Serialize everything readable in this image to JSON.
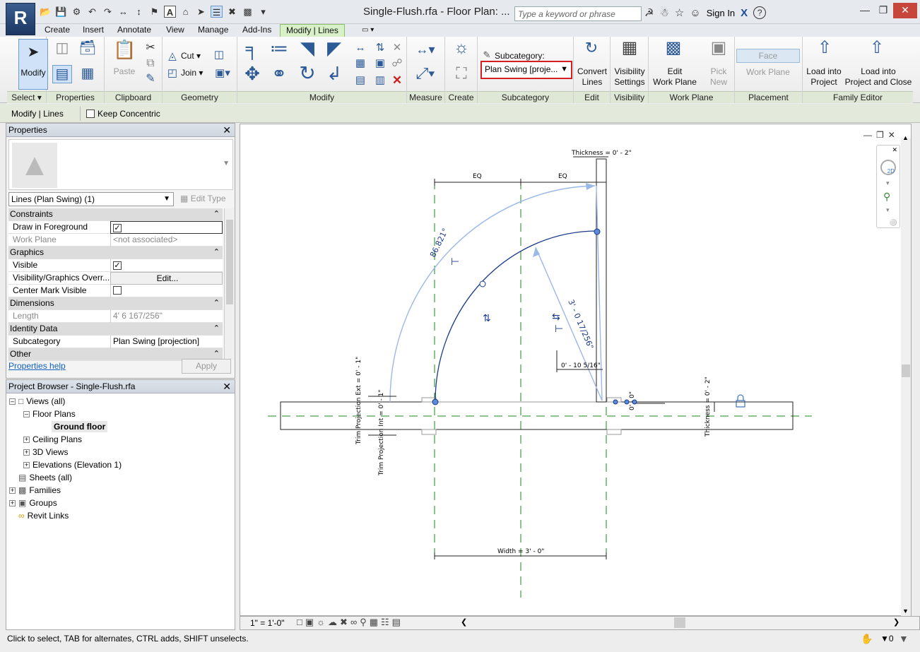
{
  "app": {
    "logo": "R",
    "window_title": "Single-Flush.rfa - Floor Plan: ...",
    "search_placeholder": "Type a keyword or phrase",
    "sign_in": "Sign In",
    "help": "?"
  },
  "tabs": [
    "Create",
    "Insert",
    "Annotate",
    "View",
    "Manage",
    "Add-Ins",
    "Modify | Lines"
  ],
  "ribbon": {
    "select": {
      "modify": "Modify",
      "footer": "Select ▾"
    },
    "properties": {
      "footer": "Properties"
    },
    "clipboard": {
      "paste": "Paste",
      "footer": "Clipboard"
    },
    "geometry": {
      "cut": "Cut",
      "join": "Join",
      "footer": "Geometry"
    },
    "modify": {
      "footer": "Modify"
    },
    "measure": {
      "footer": "Measure"
    },
    "create": {
      "footer": "Create"
    },
    "subcategory": {
      "label": "Subcategory:",
      "value": "Plan Swing [proje...",
      "footer": "Subcategory"
    },
    "edit": {
      "convert1": "Convert",
      "convert2": "Lines",
      "footer": "Edit"
    },
    "visibility": {
      "l1": "Visibility",
      "l2": "Settings",
      "footer": "Visibility"
    },
    "workplane": {
      "l1": "Edit",
      "l2": "Work Plane",
      "footer": "Work Plane"
    },
    "picknew": {
      "l1": "Pick",
      "l2": "New"
    },
    "placement": {
      "face": "Face",
      "workplane": "Work Plane",
      "footer": "Placement"
    },
    "family": {
      "load1": "Load into",
      "load2": "Project",
      "lc1": "Load into",
      "lc2": "Project and Close",
      "footer": "Family Editor"
    }
  },
  "options_bar": {
    "context": "Modify | Lines",
    "keep_concentric": "Keep Concentric"
  },
  "properties": {
    "title": "Properties",
    "type_selector": "Lines (Plan Swing) (1)",
    "edit_type": "Edit Type",
    "rows": {
      "constraints": "Constraints",
      "draw_fg": "Draw in Foreground",
      "work_plane": "Work Plane",
      "work_plane_val": "<not associated>",
      "graphics": "Graphics",
      "visible": "Visible",
      "vg_overrides": "Visibility/Graphics Overr...",
      "vg_edit": "Edit...",
      "center_mark": "Center Mark Visible",
      "dimensions": "Dimensions",
      "length": "Length",
      "length_val": "4'  6 167/256\"",
      "identity": "Identity Data",
      "subcategory": "Subcategory",
      "subcategory_val": "Plan Swing [projection]",
      "other": "Other"
    },
    "help": "Properties help",
    "apply": "Apply"
  },
  "browser": {
    "title": "Project Browser - Single-Flush.rfa",
    "items": [
      "Views (all)",
      "Floor Plans",
      "Ground floor",
      "Ceiling Plans",
      "3D Views",
      "Elevations (Elevation 1)",
      "Sheets (all)",
      "Families",
      "Groups",
      "Revit Links"
    ]
  },
  "drawing": {
    "thickness_top": "Thickness = 0' - 2\"",
    "eq": "EQ",
    "angle": "86.821°",
    "radius": "3' - 0 17/256\"",
    "offset": "0' - 10 5/16\"",
    "trim_ext": "Trim Projection Ext = 0' - 1\"",
    "trim_int": "Trim Projection Int = 0' - 1\"",
    "thickness_right": "Thickness = 0' - 2\"",
    "small_dim": "0' - 0\"",
    "width": "Width = 3' - 0\""
  },
  "view_control": {
    "scale": "1\" = 1'-0\""
  },
  "status": {
    "text": "Click to select, TAB for alternates, CTRL adds, SHIFT unselects.",
    "filter_count": "0"
  }
}
